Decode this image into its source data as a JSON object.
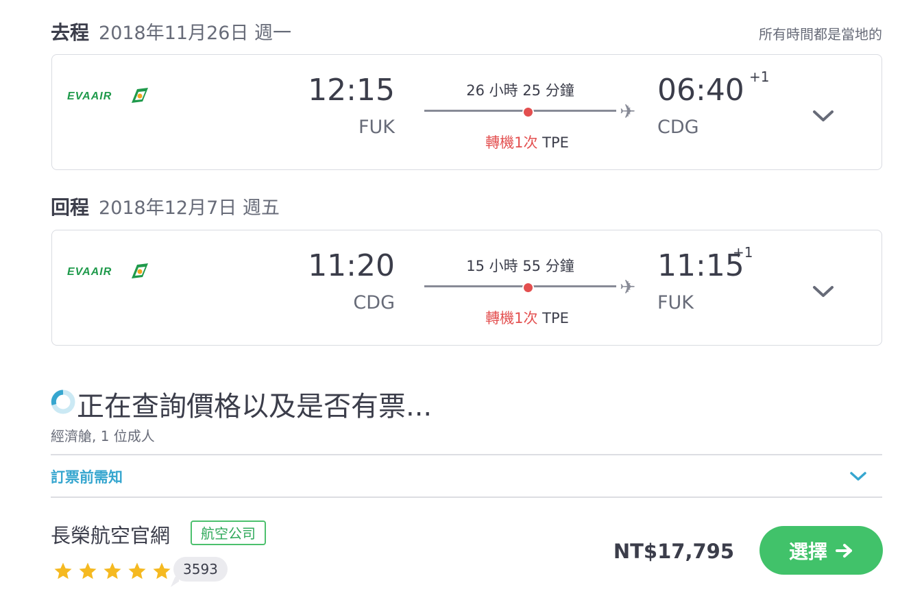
{
  "local_time_note": "所有時間都是當地的",
  "legs": [
    {
      "label": "去程",
      "date": "2018年11月26日 週一",
      "airline_logo": "EVAAIR",
      "dep_time": "12:15",
      "dep_code": "FUK",
      "duration": "26 小時 25 分鐘",
      "stops": "轉機1次",
      "via": "TPE",
      "arr_time": "06:40",
      "day_offset": "+1",
      "arr_code": "CDG"
    },
    {
      "label": "回程",
      "date": "2018年12月7日 週五",
      "airline_logo": "EVAAIR",
      "dep_time": "11:20",
      "dep_code": "CDG",
      "duration": "15 小時 55 分鐘",
      "stops": "轉機1次",
      "via": "TPE",
      "arr_time": "11:15",
      "day_offset": "+1",
      "arr_code": "FUK"
    }
  ],
  "loading": {
    "text": "正在查詢價格以及是否有票...",
    "cabin": "經濟艙, 1 位成人"
  },
  "notice": {
    "label": "訂票前需知"
  },
  "provider": {
    "name": "長榮航空官網",
    "badge": "航空公司",
    "rating": 5,
    "reviews": "3593",
    "price": "NT$17,795",
    "select_label": "選擇"
  },
  "colors": {
    "accent": "#36a6cf",
    "stop_red": "#e34f4f",
    "select_green": "#41c26a",
    "star": "#f5b921",
    "eva_green": "#1f9a4b"
  }
}
